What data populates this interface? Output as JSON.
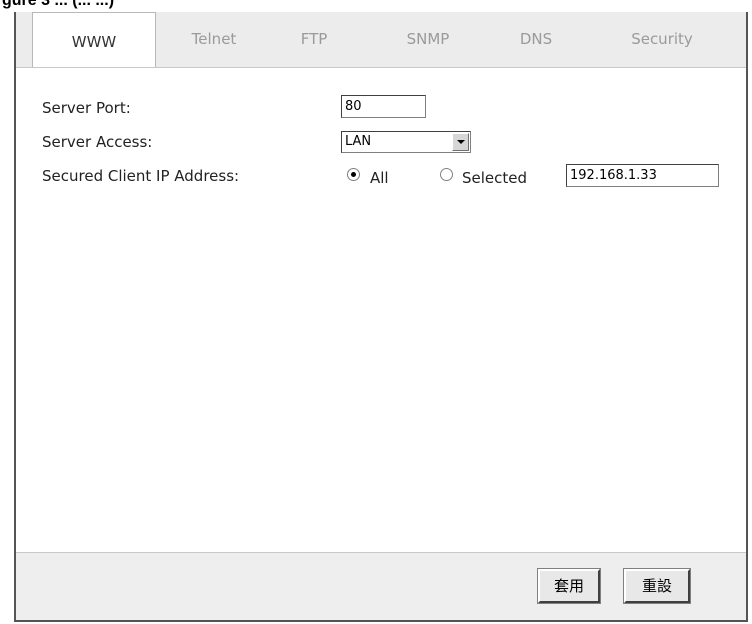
{
  "caption": "gure 3 ... (... ...)",
  "tabs": [
    {
      "label": "WWW",
      "active": true
    },
    {
      "label": "Telnet",
      "active": false
    },
    {
      "label": "FTP",
      "active": false
    },
    {
      "label": "SNMP",
      "active": false
    },
    {
      "label": "DNS",
      "active": false
    },
    {
      "label": "Security",
      "active": false
    }
  ],
  "form": {
    "server_port_label": "Server Port:",
    "server_port_value": "80",
    "server_access_label": "Server Access:",
    "server_access_value": "LAN",
    "secured_client_label": "Secured Client IP Address:",
    "radio_all_label": "All",
    "radio_all_checked": true,
    "radio_selected_label": "Selected",
    "radio_selected_checked": false,
    "ip_value": "192.168.1.33"
  },
  "buttons": {
    "apply_label": "套用",
    "reset_label": "重設"
  },
  "icons": {
    "dropdown": "chevron-down-icon"
  }
}
